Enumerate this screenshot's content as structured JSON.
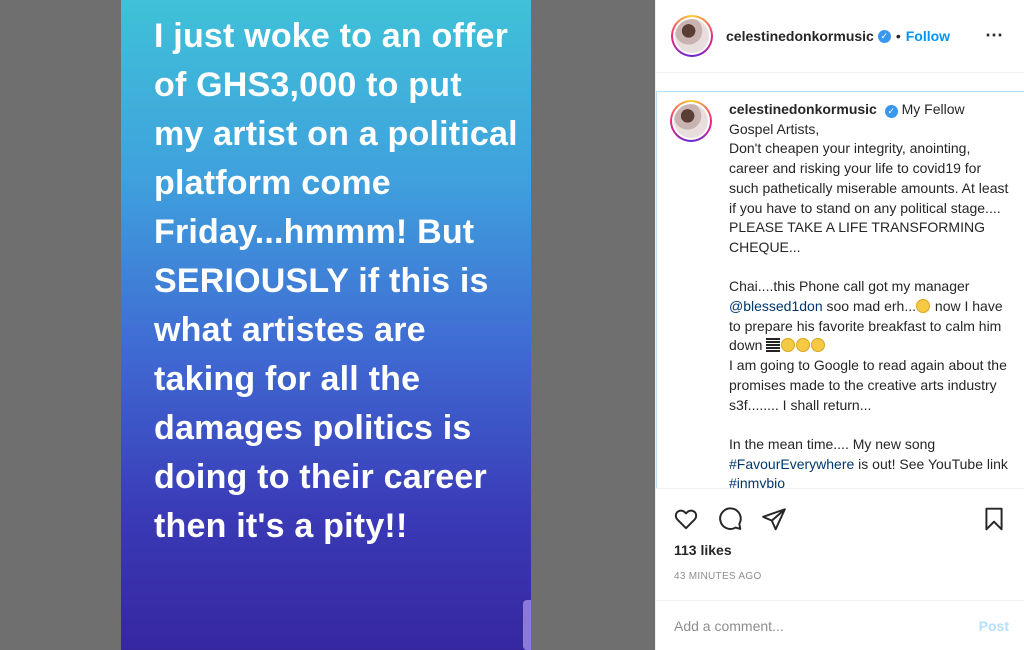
{
  "story": {
    "text": "I just woke to an offer of GHS3,000 to put my artist on a political platform come Friday...hmmm! But SERIOUSLY if this is what artistes are taking for all the damages politics is doing to their career then it's a pity!!"
  },
  "header": {
    "username": "celestinedonkormusic",
    "separator": "•",
    "follow_label": "Follow",
    "more_icon": "⋯"
  },
  "caption": {
    "username": "celestinedonkormusic",
    "line_1": "My Fellow Gospel Artists,\nDon't cheapen your integrity, anointing, career and risking your life to covid19 for such pathetically miserable amounts. At least if you have to stand on any political stage.... PLEASE TAKE A LIFE TRANSFORMING CHEQUE...\n\nChai....this Phone call got my manager ",
    "mention": "@blessed1don",
    "line_2": " soo mad erh...",
    "line_3": " now I have to prepare his favorite breakfast to calm him down ",
    "line_4": "\nI am going to Google to read again about the promises made to the creative arts industry s3f........ I shall return...\n\nIn the mean time.... My new song ",
    "hashtag": "#FavourEverywhere",
    "line_5": " is out! See YouTube link ",
    "hashtag_2": "#inmybio"
  },
  "actions": {
    "like_icon": "heart-icon",
    "comment_icon": "comment-icon",
    "share_icon": "share-icon",
    "save_icon": "bookmark-icon"
  },
  "likes": "113 likes",
  "timestamp": "43 MINUTES AGO",
  "comment": {
    "placeholder": "Add a comment...",
    "post_label": "Post"
  }
}
